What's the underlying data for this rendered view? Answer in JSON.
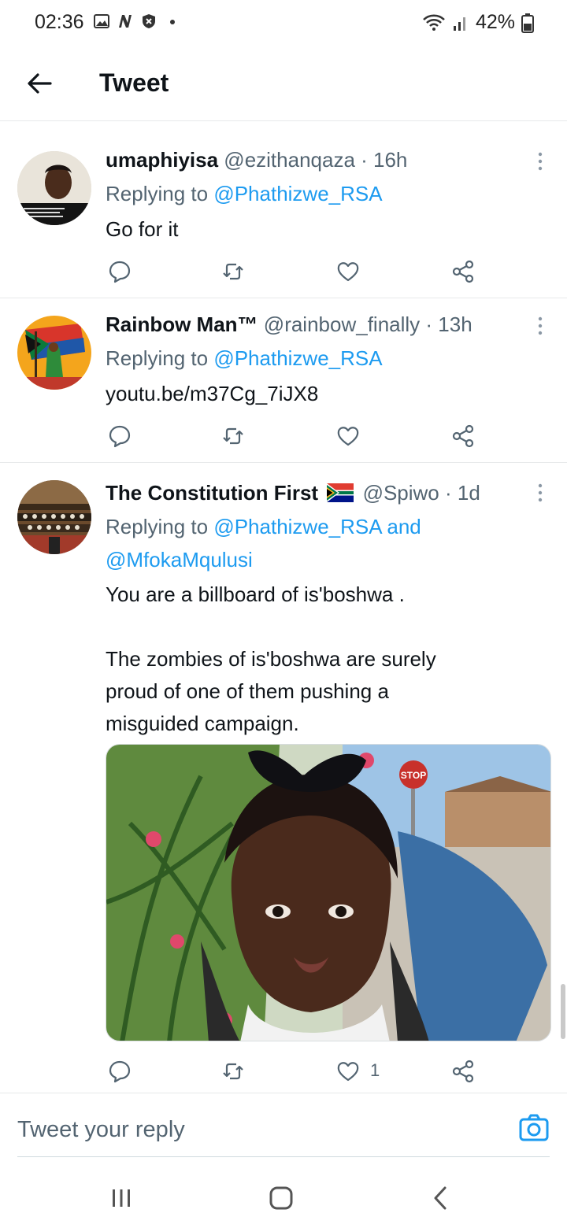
{
  "status_bar": {
    "time": "02:36",
    "battery": "42%"
  },
  "header": {
    "title": "Tweet"
  },
  "tweets": [
    {
      "name": "umaphiyisa",
      "handle": "@ezithanqaza · 16h",
      "reply_prefix": "Replying to ",
      "reply_to": "@Phathizwe_RSA",
      "text": "Go for it"
    },
    {
      "name": "Rainbow Man™",
      "handle": "@rainbow_finally · 13h",
      "reply_prefix": "Replying to ",
      "reply_to": "@Phathizwe_RSA",
      "link": "youtu.be/m37Cg_7iJX8"
    },
    {
      "name": "The Constitution First",
      "handle": "@Spiwo · 1d",
      "reply_prefix": "Replying to ",
      "reply_to": "@Phathizwe_RSA and",
      "reply_to_2": "@MfokaMqulusi",
      "text_1": "You are a billboard of is'boshwa .",
      "text_2": "The zombies of is'boshwa are surely",
      "text_3": "proud of one of them pushing a",
      "text_4": "misguided campaign.",
      "likes": "1",
      "photo_sign": "STOP"
    }
  ],
  "reply_bar": {
    "placeholder": "Tweet your reply"
  },
  "colors": {
    "link": "#1d9bf0",
    "text": "#0f1419",
    "muted": "#536471",
    "divider": "#e7e9ea"
  },
  "icons": [
    "back-arrow-icon",
    "more-vertical-icon",
    "reply-icon",
    "retweet-icon",
    "like-icon",
    "share-icon",
    "camera-icon",
    "wifi-icon",
    "signal-icon",
    "battery-icon"
  ]
}
